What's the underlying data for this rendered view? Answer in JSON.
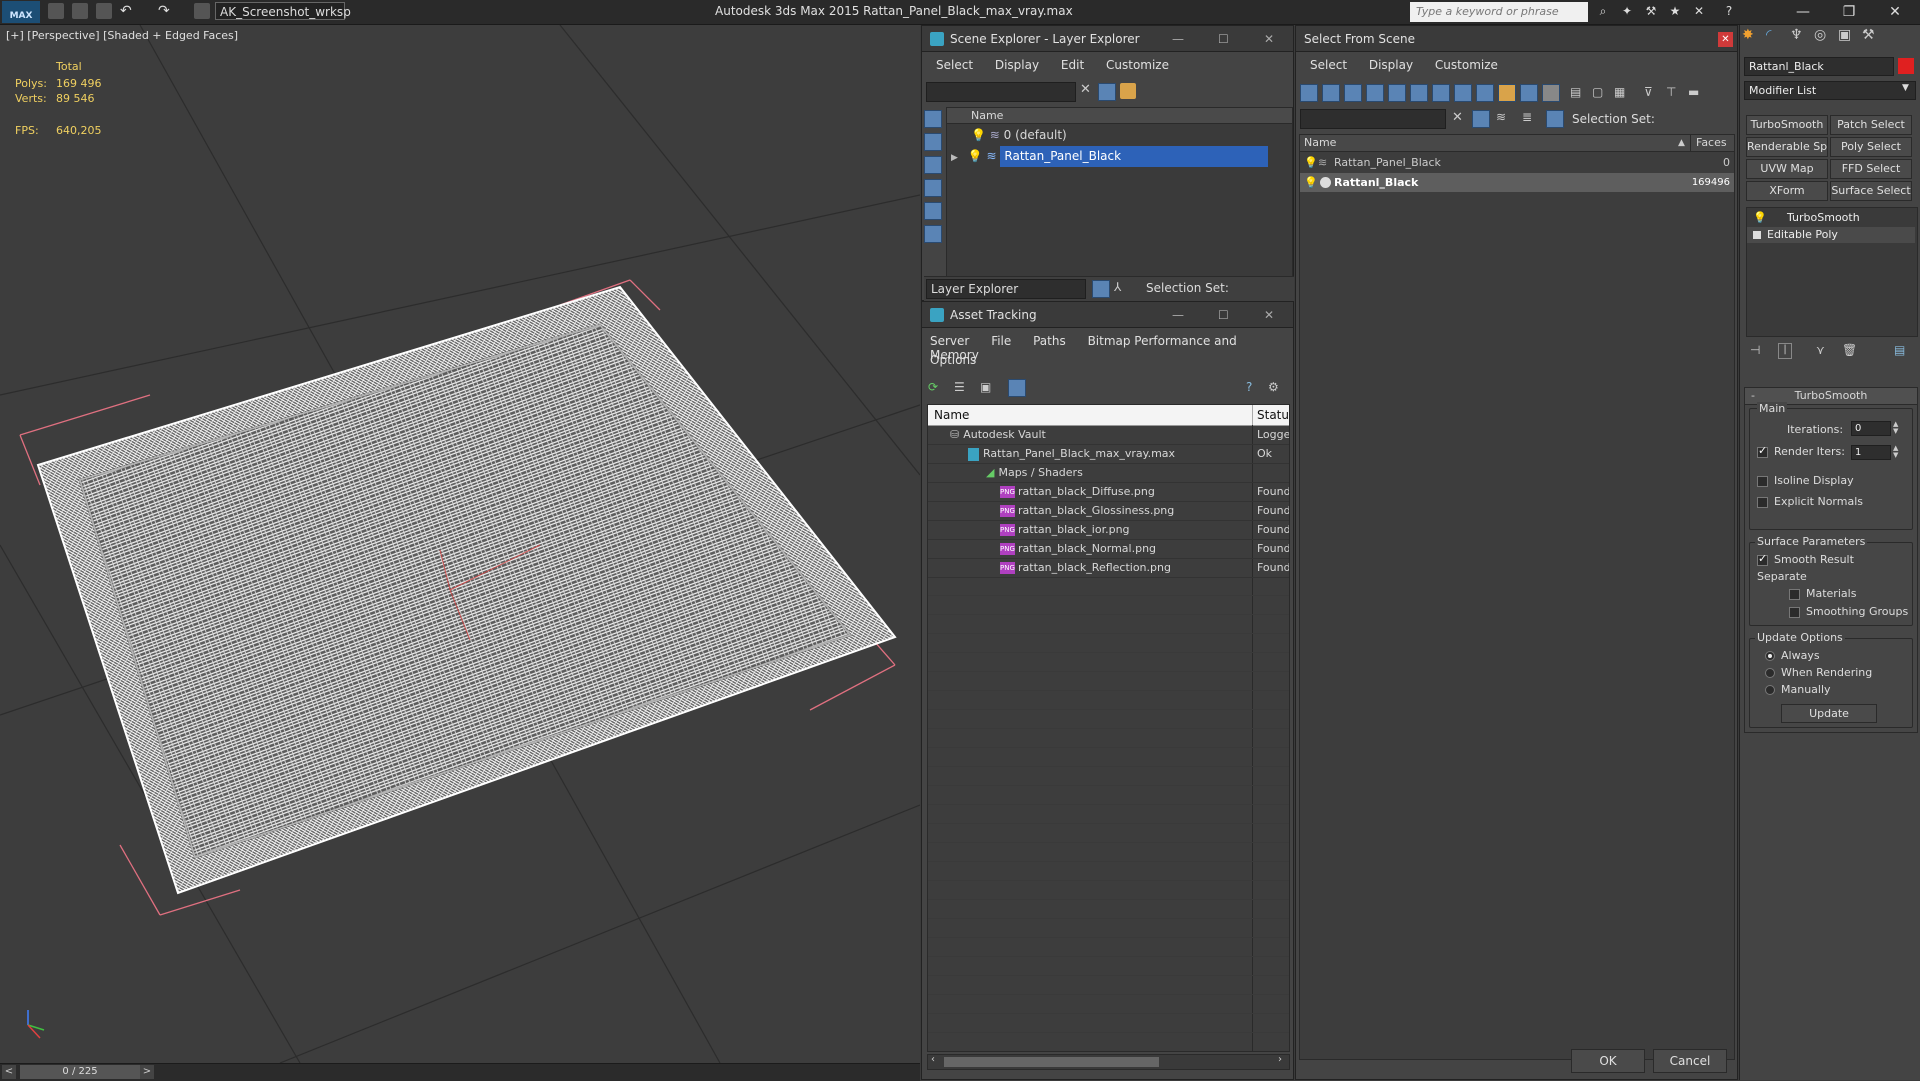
{
  "app": {
    "workspace": "AK_Screenshot_wrksp",
    "title": "Autodesk 3ds Max  2015    Rattan_Panel_Black_max_vray.max",
    "search_placeholder": "Type a keyword or phrase",
    "logo": "MAX"
  },
  "viewport": {
    "label": "[+] [Perspective] [Shaded + Edged Faces]",
    "stats": {
      "total_label": "Total",
      "polys_label": "Polys:",
      "polys_value": "169 496",
      "verts_label": "Verts:",
      "verts_value": "89 546",
      "fps_label": "FPS:",
      "fps_value": "640,205"
    }
  },
  "timeline": {
    "frame": "0 / 225",
    "prev": "<",
    "next": ">"
  },
  "scene_explorer": {
    "title": "Scene Explorer - Layer Explorer",
    "menu": [
      "Select",
      "Display",
      "Edit",
      "Customize"
    ],
    "column": "Name",
    "layers": [
      "0 (default)",
      "Rattan_Panel_Black"
    ],
    "footer_dropdown": "Layer Explorer",
    "selection_set_label": "Selection Set:"
  },
  "asset_tracking": {
    "title": "Asset Tracking",
    "menu1": [
      "Server",
      "File",
      "Paths",
      "Bitmap Performance and Memory"
    ],
    "menu2": [
      "Options"
    ],
    "columns": {
      "name": "Name",
      "status": "Status"
    },
    "rows": [
      {
        "name": "Autodesk Vault",
        "status": "Logged"
      },
      {
        "name": "Rattan_Panel_Black_max_vray.max",
        "status": "Ok"
      },
      {
        "name": "Maps / Shaders",
        "status": ""
      },
      {
        "name": "rattan_black_Diffuse.png",
        "status": "Found"
      },
      {
        "name": "rattan_black_Glossiness.png",
        "status": "Found"
      },
      {
        "name": "rattan_black_ior.png",
        "status": "Found"
      },
      {
        "name": "rattan_black_Normal.png",
        "status": "Found"
      },
      {
        "name": "rattan_black_Reflection.png",
        "status": "Found"
      }
    ],
    "png_tag": "PNG"
  },
  "select_from_scene": {
    "title": "Select From Scene",
    "menu": [
      "Select",
      "Display",
      "Customize"
    ],
    "selection_set_label": "Selection Set:",
    "columns": {
      "name": "Name",
      "faces": "Faces"
    },
    "rows": [
      {
        "name": "Rattan_Panel_Black",
        "faces": "0"
      },
      {
        "name": "Rattanl_Black",
        "faces": "169496"
      }
    ],
    "ok": "OK",
    "cancel": "Cancel"
  },
  "command_panel": {
    "object_name": "Rattanl_Black",
    "modifier_list": "Modifier List",
    "buttons": [
      "TurboSmooth",
      "Patch Select",
      "Renderable Spline",
      "Poly Select",
      "UVW Map",
      "FFD Select",
      "XForm",
      "Surface Select"
    ],
    "stack": [
      "TurboSmooth",
      "Editable Poly"
    ],
    "rollout_title": "TurboSmooth",
    "main_label": "Main",
    "iterations_label": "Iterations:",
    "iterations_value": "0",
    "render_iters_label": "Render Iters:",
    "render_iters_value": "1",
    "isoline": "Isoline Display",
    "explicit_normals": "Explicit Normals",
    "surface_params": "Surface Parameters",
    "smooth_result": "Smooth Result",
    "separate": "Separate",
    "materials": "Materials",
    "smoothing_groups": "Smoothing Groups",
    "update_options": "Update Options",
    "always": "Always",
    "when_rendering": "When Rendering",
    "manually": "Manually",
    "update": "Update"
  }
}
